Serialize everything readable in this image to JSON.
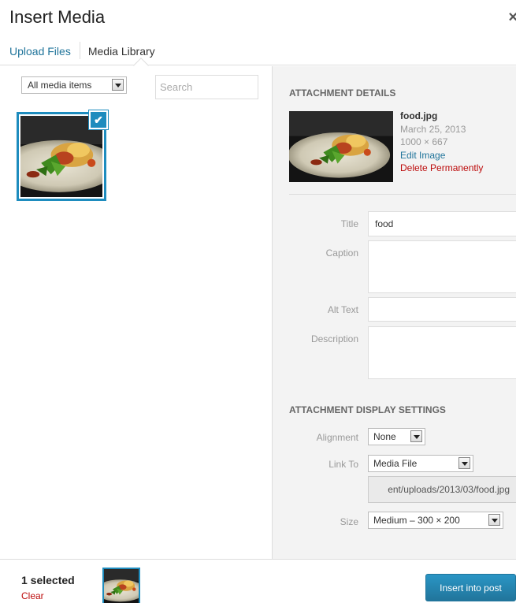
{
  "modal": {
    "title": "Insert Media",
    "close_icon": "×"
  },
  "tabs": [
    {
      "label": "Upload Files"
    },
    {
      "label": "Media Library"
    }
  ],
  "library": {
    "filter_selected": "All media items",
    "search_placeholder": "Search",
    "selected_item_icon": "check-icon",
    "check_glyph": "✔"
  },
  "details": {
    "section_title": "ATTACHMENT DETAILS",
    "filename": "food.jpg",
    "date": "March 25, 2013",
    "dimensions": "1000 × 667",
    "edit_link": "Edit Image",
    "delete_link": "Delete Permanently",
    "fields": {
      "title_label": "Title",
      "title_value": "food",
      "caption_label": "Caption",
      "caption_value": "",
      "alt_label": "Alt Text",
      "alt_value": "",
      "description_label": "Description",
      "description_value": ""
    }
  },
  "display_settings": {
    "section_title": "ATTACHMENT DISPLAY SETTINGS",
    "alignment_label": "Alignment",
    "alignment_value": "None",
    "link_to_label": "Link To",
    "link_to_value": "Media File",
    "url_value": "ent/uploads/2013/03/food.jpg",
    "size_label": "Size",
    "size_value": "Medium – 300 × 200"
  },
  "footer": {
    "selected_count": "1 selected",
    "clear_label": "Clear",
    "insert_button": "Insert into post"
  },
  "colors": {
    "accent": "#1e8cbe",
    "link": "#21759b",
    "danger": "#bc0b0b",
    "sidebar_bg": "#f3f3f3"
  }
}
